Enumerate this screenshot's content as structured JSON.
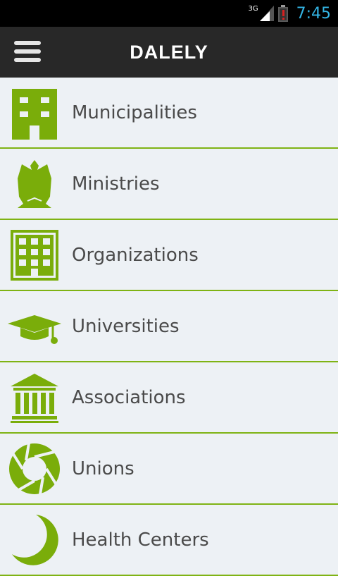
{
  "status_bar": {
    "network": "3G",
    "time": "7:45"
  },
  "app_bar": {
    "title": "DALELY"
  },
  "colors": {
    "accent": "#7fb314",
    "icon_green": "#7aad0a",
    "app_bar_bg": "#282828",
    "list_bg": "#edf1f5",
    "label_text": "#4a4a4a",
    "clock": "#33b5e5",
    "battery_alert": "#d62020"
  },
  "list": {
    "items": [
      {
        "label": "Municipalities",
        "icon": "municipal-building-icon"
      },
      {
        "label": "Ministries",
        "icon": "eagle-emblem-icon"
      },
      {
        "label": "Organizations",
        "icon": "office-building-icon"
      },
      {
        "label": "Universities",
        "icon": "graduation-cap-icon"
      },
      {
        "label": "Associations",
        "icon": "columned-building-icon"
      },
      {
        "label": "Unions",
        "icon": "aperture-icon"
      },
      {
        "label": "Health Centers",
        "icon": "crescent-icon"
      }
    ]
  }
}
